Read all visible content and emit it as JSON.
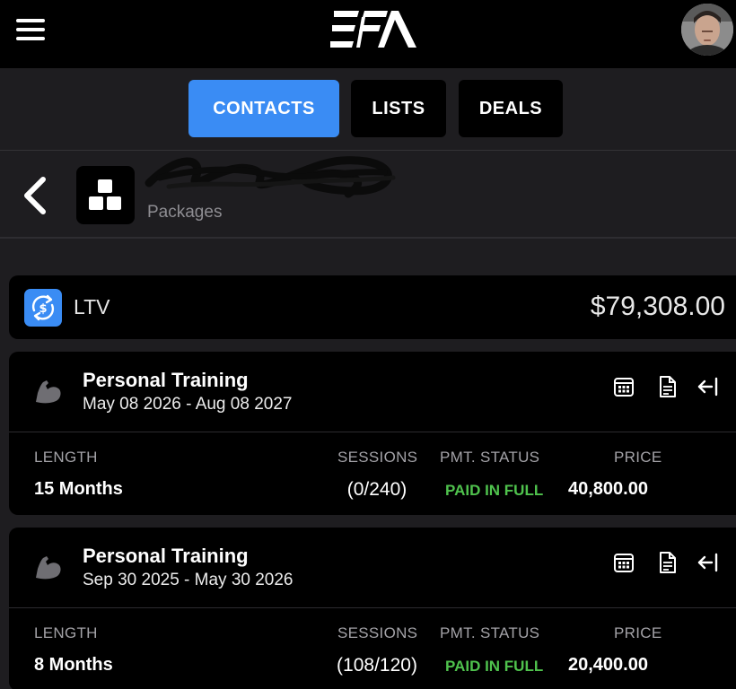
{
  "app": {
    "logo_text": "EFA"
  },
  "tabs": [
    {
      "label": "CONTACTS",
      "active": true
    },
    {
      "label": "LISTS",
      "active": false
    },
    {
      "label": "DEALS",
      "active": false
    }
  ],
  "contact": {
    "section": "Packages"
  },
  "ltv": {
    "label": "LTV",
    "value": "$79,308.00"
  },
  "columns": {
    "length": "LENGTH",
    "sessions": "SESSIONS",
    "pmt_status": "PMT. STATUS",
    "price": "PRICE"
  },
  "packages": [
    {
      "title": "Personal Training",
      "dates": "May 08 2026 - Aug 08 2027",
      "length": "15 Months",
      "sessions": "(0/240)",
      "pmt_status": "PAID IN FULL",
      "price": "40,800.00"
    },
    {
      "title": "Personal Training",
      "dates": "Sep 30 2025 - May 30 2026",
      "length": "8 Months",
      "sessions": "(108/120)",
      "pmt_status": "PAID IN FULL",
      "price": "20,400.00"
    }
  ],
  "icons": {
    "menu": "hamburger-icon",
    "back": "chevron-left-icon",
    "package": "boxes-icon",
    "ltv": "money-cycle-icon",
    "package_type": "flexed-arm-icon",
    "actions": [
      "calendar-icon",
      "invoice-icon",
      "exit-icon"
    ]
  },
  "colors": {
    "accent": "#3a8cf4",
    "paid": "#4fc24d",
    "background": "#1e1d20",
    "card": "#000000"
  }
}
